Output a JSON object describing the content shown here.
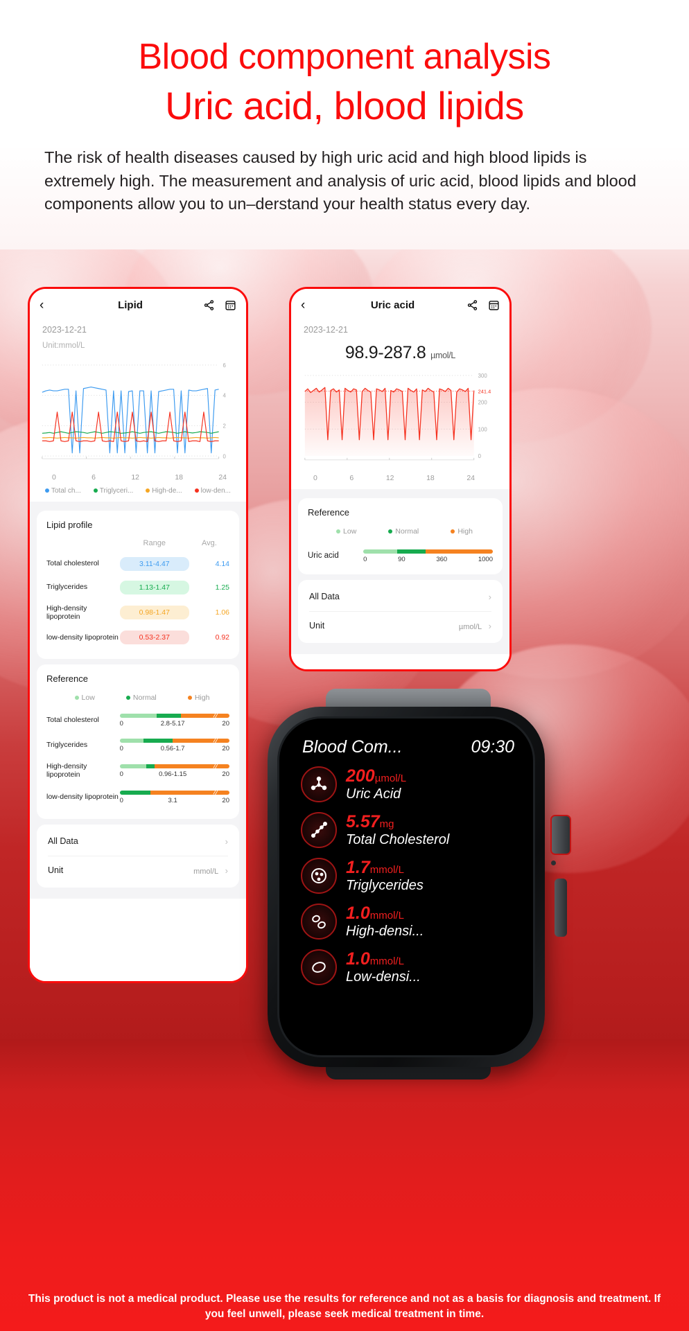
{
  "header": {
    "headline_1": "Blood component analysis",
    "headline_2": "Uric acid, blood lipids",
    "intro": "The risk of health diseases caused by high uric acid and high blood lipids is extremely high. The measurement and analysis of uric acid, blood lipids and blood components allow you to un–derstand your health status every day.",
    "headline_color": "#fb0c0c"
  },
  "lipid_screen": {
    "nav": {
      "back_icon": "chevron-left-icon",
      "title": "Lipid",
      "share_icon": "share-icon",
      "calendar_icon": "calendar-icon"
    },
    "date": "2023-12-21",
    "unit_line": "Unit:mmol/L",
    "chart_data": {
      "type": "line",
      "title": "Lipid",
      "xlabel": "",
      "ylabel": "mmol/L",
      "xlim": [
        0,
        24
      ],
      "ylim": [
        0,
        6
      ],
      "xticks": [
        "0",
        "6",
        "12",
        "18",
        "24"
      ],
      "yticks": [
        "0",
        "2",
        "4",
        "6"
      ],
      "grid": true,
      "legend_position": "bottom",
      "series": [
        {
          "name": "Total ch...",
          "full_name": "Total cholesterol",
          "color": "#3d9bf0",
          "baseline": 4.3,
          "values": [
            4.2,
            4.3,
            4.35,
            4.3,
            4.3,
            4.35,
            4.4,
            4.4,
            0.2,
            4.3,
            0.2,
            4.45,
            4.5,
            4.55,
            4.5,
            4.45,
            4.4,
            4.35,
            0.2,
            4.3,
            0.2,
            4.3,
            0.2,
            4.25,
            4.3,
            0.2,
            4.3,
            4.3,
            0.2,
            4.3,
            0.2,
            4.25,
            4.3,
            4.35,
            4.4,
            4.4,
            0.2,
            4.3,
            0.2,
            4.35,
            4.3,
            4.3,
            4.35,
            4.4,
            4.45,
            0.2,
            4.35,
            4.4
          ]
        },
        {
          "name": "Triglyceri...",
          "full_name": "Triglycerides",
          "color": "#17ab4f",
          "baseline": 1.55,
          "values": [
            1.5,
            1.52,
            1.55,
            1.5,
            1.55,
            1.6,
            1.55,
            1.5,
            1.55,
            1.6,
            1.58,
            1.55,
            1.5,
            1.55,
            1.6,
            1.55,
            1.5,
            1.55,
            1.6,
            1.58,
            1.55,
            1.5,
            1.52,
            1.55,
            1.6,
            1.55,
            1.5,
            1.55,
            1.58,
            1.6,
            1.55,
            1.5,
            1.55,
            1.6,
            1.58,
            1.55,
            1.5,
            1.55,
            1.6,
            1.55,
            1.52,
            1.55,
            1.6,
            1.58,
            1.55,
            1.5,
            1.55,
            1.6
          ]
        },
        {
          "name": "High-de...",
          "full_name": "High-density lipoprotein",
          "color": "#f5a623",
          "baseline": 1.2,
          "values": [
            1.2,
            1.2,
            1.22,
            1.2,
            1.18,
            1.2,
            1.22,
            1.2,
            1.2,
            1.18,
            1.2,
            1.22,
            1.2,
            1.2,
            1.18,
            1.2,
            1.22,
            1.2,
            1.2,
            1.18,
            1.2,
            1.22,
            1.2,
            1.2,
            1.18,
            1.2,
            1.22,
            1.2,
            1.2,
            1.18,
            1.2,
            1.22,
            1.2,
            1.2,
            1.18,
            1.2,
            1.22,
            1.2,
            1.2,
            1.18,
            1.2,
            1.22,
            1.2,
            1.2,
            1.18,
            1.2,
            1.22,
            1.2
          ]
        },
        {
          "name": "low-den...",
          "full_name": "low-density lipoprotein",
          "color": "#f5311f",
          "baseline": 1.0,
          "values": [
            1.0,
            1.0,
            0.95,
            1.0,
            2.9,
            1.0,
            0.95,
            1.0,
            2.9,
            1.0,
            0.95,
            1.0,
            1.0,
            0.95,
            1.0,
            2.9,
            1.0,
            0.95,
            1.0,
            0.95,
            2.9,
            1.0,
            0.95,
            1.0,
            2.9,
            1.0,
            0.95,
            1.0,
            0.95,
            2.9,
            1.0,
            0.95,
            1.0,
            1.0,
            2.9,
            1.0,
            0.95,
            1.0,
            2.9,
            0.95,
            1.0,
            1.0,
            0.95,
            2.9,
            1.0,
            0.95,
            1.0,
            1.0
          ]
        }
      ]
    },
    "profile": {
      "title": "Lipid profile",
      "columns": [
        "",
        "Range",
        "Avg."
      ],
      "rows": [
        {
          "name": "Total cholesterol",
          "range": "3.11-4.47",
          "avg": "4.14",
          "color": "#3d9bf0",
          "bg": "#d9ecfb"
        },
        {
          "name": "Triglycerides",
          "range": "1.13-1.47",
          "avg": "1.25",
          "color": "#17ab4f",
          "bg": "#d6f7e2"
        },
        {
          "name": "High-density lipoprotein",
          "range": "0.98-1.47",
          "avg": "1.06",
          "color": "#f5a623",
          "bg": "#fdeed2"
        },
        {
          "name": "low-density lipoprotein",
          "range": "0.53-2.37",
          "avg": "0.92",
          "color": "#f5311f",
          "bg": "#fbdedb"
        }
      ]
    },
    "reference": {
      "title": "Reference",
      "legend": [
        {
          "label": "Low",
          "color": "#9fe0ab"
        },
        {
          "label": "Normal",
          "color": "#17ab4f"
        },
        {
          "label": "High",
          "color": "#f58220"
        }
      ],
      "rows": [
        {
          "name": "Total cholesterol",
          "min": "0",
          "normal": "2.8-5.17",
          "max": "20",
          "low_pct": 34,
          "norm_pct": 22
        },
        {
          "name": "Triglycerides",
          "min": "0",
          "normal": "0.56-1.7",
          "max": "20",
          "low_pct": 22,
          "norm_pct": 26
        },
        {
          "name": "High-density lipoprotein",
          "min": "0",
          "normal": "0.96-1.15",
          "max": "20",
          "low_pct": 24,
          "norm_pct": 8
        },
        {
          "name": "low-density lipoprotein",
          "min": "0",
          "normal": "3.1",
          "max": "20",
          "low_pct": 0,
          "norm_pct": 28
        }
      ]
    },
    "links": {
      "all_data_label": "All Data",
      "unit_label": "Unit",
      "unit_value": "mmol/L",
      "chevron_icon": "chevron-right-icon"
    }
  },
  "uric_screen": {
    "nav": {
      "back_icon": "chevron-left-icon",
      "title": "Uric acid",
      "share_icon": "share-icon",
      "calendar_icon": "calendar-icon"
    },
    "date": "2023-12-21",
    "big_value": "98.9-287.8",
    "big_unit": "µmol/L",
    "chart_data": {
      "type": "area",
      "title": "Uric acid",
      "xlabel": "",
      "ylabel": "µmol/L",
      "xlim": [
        0,
        24
      ],
      "ylim": [
        0,
        300
      ],
      "xticks": [
        "0",
        "6",
        "12",
        "18",
        "24"
      ],
      "yticks": [
        "0",
        "100",
        "200",
        "300"
      ],
      "marker_label": "241.4",
      "marker_value": 241.4,
      "grid": true,
      "color": "#f5311f",
      "values": [
        240,
        250,
        236,
        244,
        252,
        238,
        246,
        255,
        60,
        244,
        250,
        238,
        246,
        60,
        252,
        244,
        238,
        250,
        246,
        60,
        240,
        252,
        244,
        238,
        60,
        250,
        246,
        240,
        252,
        60,
        244,
        238,
        250,
        246,
        240,
        60,
        252,
        244,
        238,
        250,
        60,
        246,
        240,
        252,
        244,
        238,
        60,
        250,
        246,
        240,
        252,
        244,
        60,
        238,
        250,
        246,
        240,
        252,
        60,
        244
      ]
    },
    "reference": {
      "title": "Reference",
      "legend": [
        {
          "label": "Low",
          "color": "#9fe0ab"
        },
        {
          "label": "Normal",
          "color": "#17ab4f"
        },
        {
          "label": "High",
          "color": "#f58220"
        }
      ],
      "row_name": "Uric acid",
      "ticks": [
        "0",
        "90",
        "360",
        "1000"
      ],
      "low_pct": 26,
      "norm_pct": 22
    },
    "links": {
      "all_data_label": "All Data",
      "unit_label": "Unit",
      "unit_value": "µmol/L",
      "chevron_icon": "chevron-right-icon"
    }
  },
  "watch": {
    "title": "Blood Com...",
    "time": "09:30",
    "items": [
      {
        "value": "200",
        "unit": "µmol/L",
        "label": "Uric Acid",
        "icon": "molecule-triangle-icon"
      },
      {
        "value": "5.57",
        "unit": "mg",
        "label": "Total Cholesterol",
        "icon": "molecule-chain-icon"
      },
      {
        "value": "1.7",
        "unit": "mmol/L",
        "label": "Triglycerides",
        "icon": "molecule-cluster-icon"
      },
      {
        "value": "1.0",
        "unit": "mmol/L",
        "label": "High-densi...",
        "icon": "molecule-pair-icon"
      },
      {
        "value": "1.0",
        "unit": "mmol/L",
        "label": "Low-densi...",
        "icon": "molecule-oval-icon"
      }
    ],
    "value_color": "#f21f1f"
  },
  "footer": {
    "disclaimer": "This product is not a medical product. Please use the results for reference and not as a basis for diagnosis and treatment. If you feel unwell, please seek medical treatment in time."
  }
}
